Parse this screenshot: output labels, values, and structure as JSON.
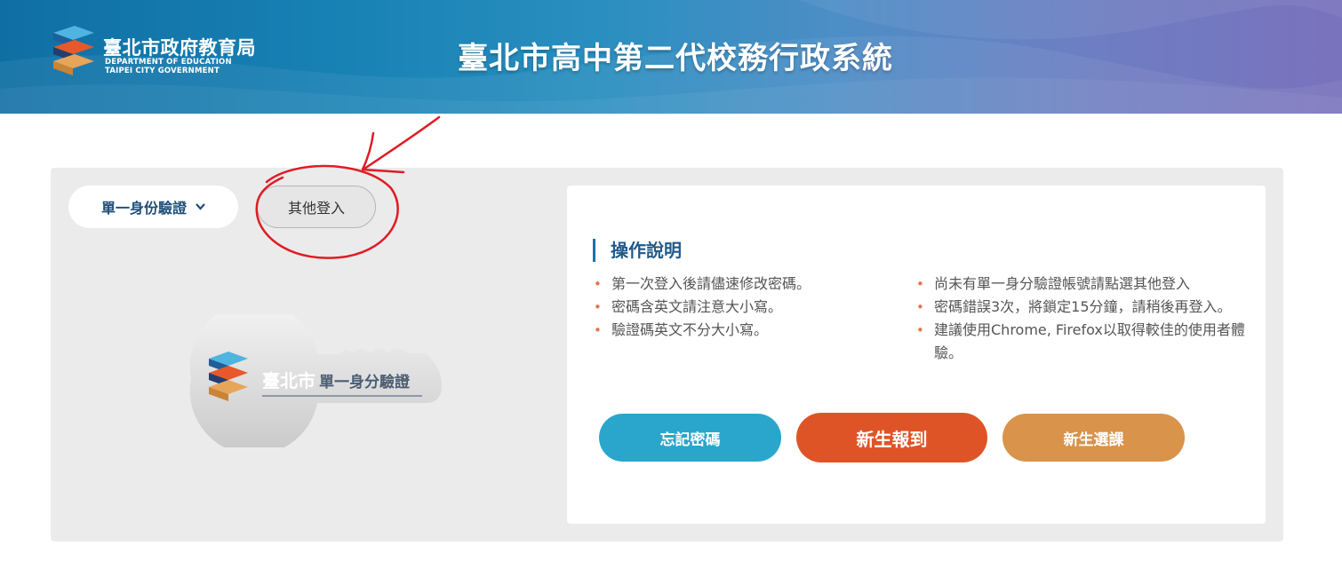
{
  "header": {
    "logo": {
      "title": "臺北市政府教育局",
      "en_line1": "DEPARTMENT OF EDUCATION",
      "en_line2": "TAIPEI CITY GOVERNMENT"
    },
    "site_title": "臺北市高中第二代校務行政系統"
  },
  "login_tabs": {
    "sso_label": "單一身份驗證",
    "sso_icon": "chevron-down-icon",
    "other_label": "其他登入"
  },
  "key_logo": {
    "text_prefix": "臺北市",
    "text_main": "單一身分驗證"
  },
  "info": {
    "title": "操作說明",
    "left_notes": [
      "第一次登入後請儘速修改密碼。",
      "密碼含英文請注意大小寫。",
      "驗證碼英文不分大小寫。"
    ],
    "right_notes": [
      "尚未有單一身分驗證帳號請點選其他登入",
      "密碼錯誤3次，將鎖定15分鐘，請稍後再登入。",
      "建議使用Chrome, Firefox以取得較佳的使用者體驗。"
    ]
  },
  "actions": {
    "forgot_password": "忘記密碼",
    "new_student_register": "新生報到",
    "new_student_course": "新生選課"
  },
  "colors": {
    "header_start": "#0f6fa4",
    "header_end": "#7a72bd",
    "forgot_button": "#2aa6cc",
    "register_button": "#df5426",
    "course_button": "#d9934a",
    "annotation": "#e01b24",
    "bullet": "#e8734b"
  }
}
